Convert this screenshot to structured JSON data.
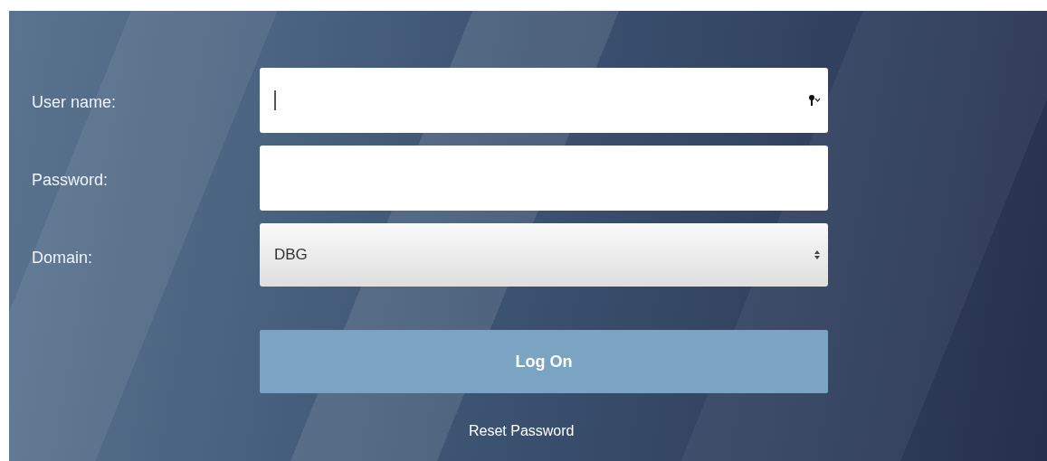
{
  "form": {
    "fields": [
      {
        "kind": "text",
        "label": "User name:",
        "focused": true,
        "key_icon": true
      },
      {
        "kind": "password",
        "label": "Password:",
        "focused": false,
        "key_icon": false
      },
      {
        "kind": "select",
        "label": "Domain:",
        "value": "DBG",
        "focused": false,
        "key_icon": false
      }
    ],
    "submit": {
      "label": "Log On"
    },
    "link": {
      "label": "Reset Password"
    }
  }
}
